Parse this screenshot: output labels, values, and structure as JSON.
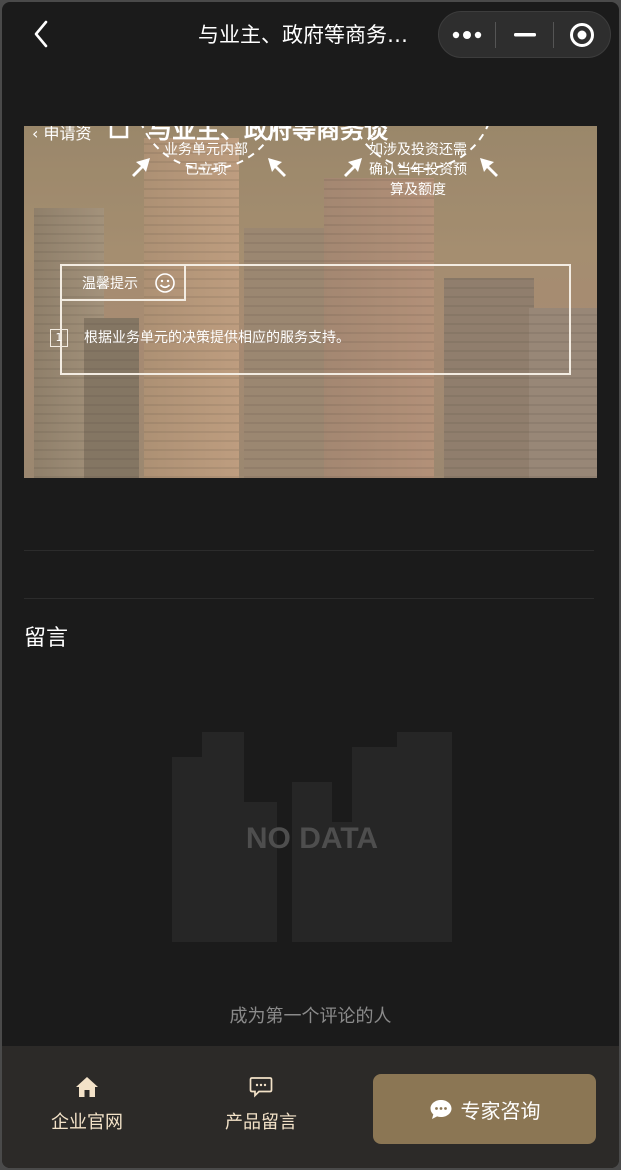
{
  "navbar": {
    "title": "与业主、政府等商务…",
    "more_label": "•••"
  },
  "banner": {
    "back_label": "申请资",
    "title": "与业主、政府等商务谈",
    "circle_left": [
      "业务单元内部",
      "已立项"
    ],
    "circle_right": [
      "如涉及投资还需",
      "确认当年投资预",
      "算及额度"
    ],
    "tip_title": "温馨提示",
    "tip_number": "1",
    "tip_text": "根据业务单元的决策提供相应的服务支持。"
  },
  "comments": {
    "section_title": "留言",
    "nodata_label": "NO DATA",
    "empty_hint": "成为第一个评论的人"
  },
  "tabbar": {
    "home_label": "企业官网",
    "message_label": "产品留言",
    "consult_label": "专家咨询"
  },
  "colors": {
    "background": "#1b1b1b",
    "tabbar": "#2c2a28",
    "accent": "#8b7654",
    "tab_text": "#f3e2c8"
  }
}
